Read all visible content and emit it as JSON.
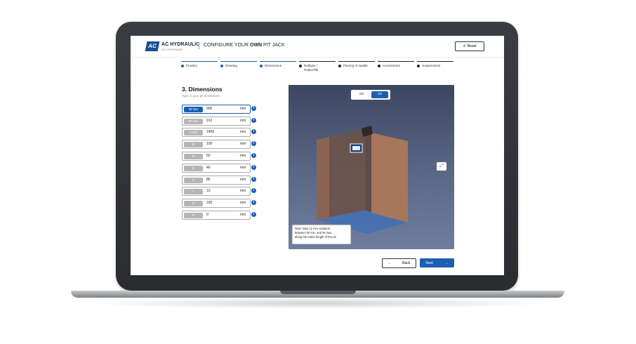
{
  "header": {
    "logo_mark": "AC",
    "brand": "AC HYDRAULIC",
    "brand_sub": "NO COMPROMISE",
    "configure_prefix": "CONFIGURE YOUR ",
    "configure_bold": "OWN",
    "configure_suffix": " PIT JACK",
    "reset_label": "Reset"
  },
  "steps": [
    {
      "label": "Product"
    },
    {
      "label": "Drawing"
    },
    {
      "label": "Dimensions"
    },
    {
      "label": "Rolltype / Railprofile"
    },
    {
      "label": "Placing of saddle"
    },
    {
      "label": "Accessories"
    },
    {
      "label": "Suspensions"
    }
  ],
  "dimensions": {
    "title": "3. Dimensions",
    "subtitle": "Type in your pit dimensions",
    "unit": "mm",
    "rows": [
      {
        "label": "W min",
        "value": "900"
      },
      {
        "label": "W max",
        "value": "912"
      },
      {
        "label": "A min",
        "value": "1400"
      },
      {
        "label": "B",
        "value": "100"
      },
      {
        "label": "D",
        "value": "50"
      },
      {
        "label": "E",
        "value": "40"
      },
      {
        "label": "H",
        "value": "85"
      },
      {
        "label": "T",
        "value": "10"
      },
      {
        "label": "C",
        "value": "100"
      },
      {
        "label": "P",
        "value": "0"
      }
    ]
  },
  "viewer": {
    "toggle_2d": "2D",
    "toggle_3d": "3D",
    "note_line1": "Note: Max 12 mm variation",
    "note_line2": "between W min. and W max.",
    "note_line3": "along the entire length of the pit"
  },
  "footer": {
    "back_label": "Back",
    "next_label": "Next"
  }
}
